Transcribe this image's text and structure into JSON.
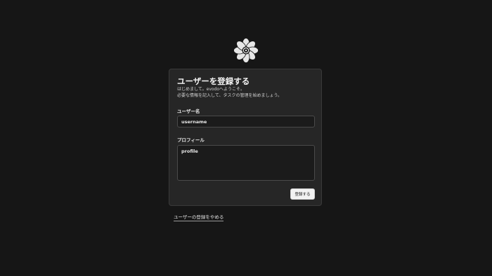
{
  "logo": {
    "icon": "evodo-logo-icon"
  },
  "register_form": {
    "title": "ユーザーを登録する",
    "intro_line1": "はじめまして。evodoへようこそ。",
    "intro_line2": "必要な情報を記入して、タスクの管理を始めましょう。",
    "username_label": "ユーザー名",
    "username_value": "username",
    "profile_label": "プロフィール",
    "profile_value": "profile",
    "submit_label": "登録する"
  },
  "cancel_link": {
    "label": "ユーザーの登録をやめる"
  },
  "colors": {
    "background": "#161616",
    "card": "#262626",
    "field": "#1b1b1b",
    "button": "#f2f2f2"
  }
}
